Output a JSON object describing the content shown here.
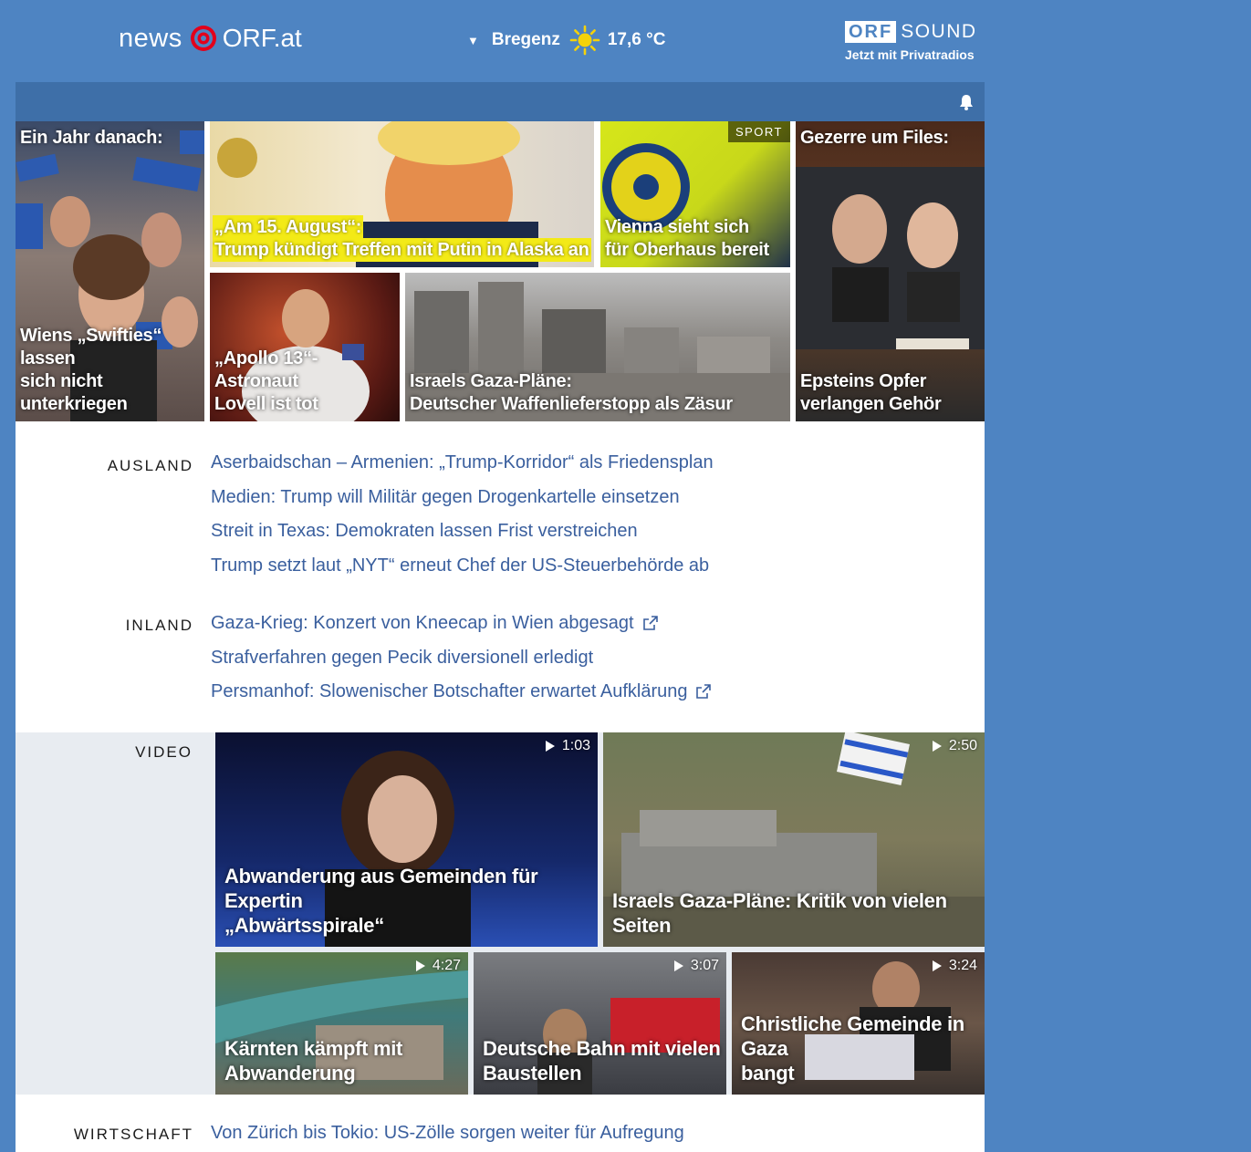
{
  "header": {
    "logo_news": "news",
    "logo_orf": "ORF.at",
    "weather": {
      "location": "Bregenz",
      "temperature": "17,6 °C",
      "icon": "sun-icon"
    },
    "sound": {
      "brand": "ORF",
      "name": "SOUND",
      "subtitle": "Jetzt mit Privatradios"
    }
  },
  "topbar": {
    "icon": "bell-icon"
  },
  "stories": [
    {
      "label": "Ein Jahr danach:",
      "caption_line1": "Wiens „Swifties“ lassen",
      "caption_line2": "sich nicht unterkriegen"
    },
    {
      "caption_line1": "„Am 15. August“:",
      "caption_line2": "Trump kündigt Treffen mit Putin in Alaska an"
    },
    {
      "badge": "SPORT",
      "caption_line1": "Vienna sieht sich",
      "caption_line2": "für Oberhaus bereit"
    },
    {
      "label": "Gezerre um Files:",
      "caption_line1": "Epsteins Opfer",
      "caption_line2": "verlangen Gehör"
    },
    {
      "caption_line1": "„Apollo 13“-Astronaut",
      "caption_line2": "Lovell ist tot"
    },
    {
      "caption_line1": "Israels Gaza-Pläne:",
      "caption_line2": "Deutscher Waffenlieferstopp als Zäsur"
    }
  ],
  "ausland": {
    "label": "AUSLAND",
    "items": [
      "Aserbaidschan – Armenien: „Trump-Korridor“ als Friedensplan",
      "Medien: Trump will Militär gegen Drogenkartelle einsetzen",
      "Streit in Texas: Demokraten lassen Frist verstreichen",
      "Trump setzt laut „NYT“ erneut Chef der US-Steuerbehörde ab"
    ]
  },
  "inland": {
    "label": "INLAND",
    "items": [
      "Gaza-Krieg: Konzert von Kneecap in Wien abgesagt",
      "Strafverfahren gegen Pecik diversionell erledigt",
      "Persmanhof: Slowenischer Botschafter erwartet Aufklärung"
    ]
  },
  "video": {
    "label": "VIDEO",
    "items": [
      {
        "duration": "1:03",
        "line1": "Abwanderung aus Gemeinden für Expertin",
        "line2": "„Abwärtsspirale“"
      },
      {
        "duration": "2:50",
        "line1": "Israels Gaza-Pläne: Kritik von vielen Seiten",
        "line2": ""
      },
      {
        "duration": "4:27",
        "line1": "Kärnten kämpft mit",
        "line2": "Abwanderung"
      },
      {
        "duration": "3:07",
        "line1": "Deutsche Bahn mit vielen",
        "line2": "Baustellen"
      },
      {
        "duration": "3:24",
        "line1": "Christliche Gemeinde in Gaza",
        "line2": "bangt"
      }
    ]
  },
  "wirtschaft": {
    "label": "WIRTSCHAFT",
    "items": [
      "Von Zürich bis Tokio: US-Zölle sorgen weiter für Aufregung"
    ]
  }
}
